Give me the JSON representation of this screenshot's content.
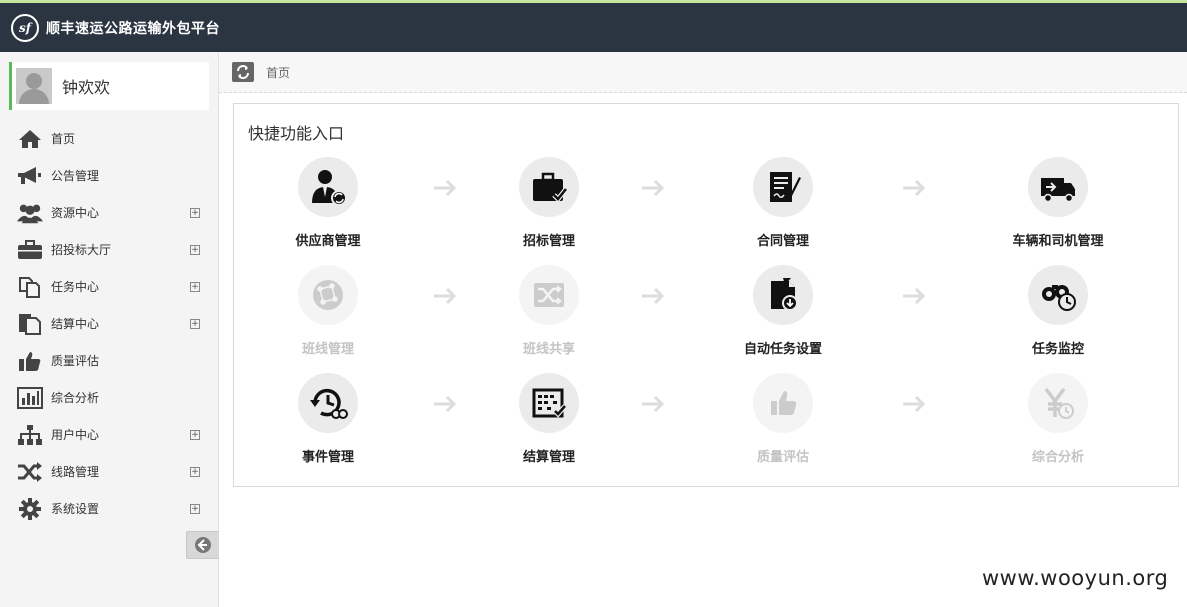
{
  "header": {
    "logo_text": "sf",
    "title": "顺丰速运公路运输外包平台"
  },
  "user": {
    "name": "钟欢欢"
  },
  "sidebar": {
    "items": [
      {
        "label": "首页",
        "icon": "home-icon",
        "expandable": false
      },
      {
        "label": "公告管理",
        "icon": "megaphone-icon",
        "expandable": false
      },
      {
        "label": "资源中心",
        "icon": "users-icon",
        "expandable": true
      },
      {
        "label": "招投标大厅",
        "icon": "briefcase-icon",
        "expandable": true
      },
      {
        "label": "任务中心",
        "icon": "copy-icon",
        "expandable": true
      },
      {
        "label": "结算中心",
        "icon": "document-icon",
        "expandable": true
      },
      {
        "label": "质量评估",
        "icon": "thumbs-up-icon",
        "expandable": false
      },
      {
        "label": "综合分析",
        "icon": "bar-chart-icon",
        "expandable": false
      },
      {
        "label": "用户中心",
        "icon": "sitemap-icon",
        "expandable": true
      },
      {
        "label": "线路管理",
        "icon": "shuffle-icon",
        "expandable": true
      },
      {
        "label": "系统设置",
        "icon": "gear-icon",
        "expandable": true
      }
    ],
    "expand_symbol": "+"
  },
  "breadcrumb": {
    "current": "首页"
  },
  "quick_panel": {
    "title": "快捷功能入口",
    "tiles": [
      {
        "label": "供应商管理",
        "icon": "supplier-icon",
        "enabled": true
      },
      {
        "label": "招标管理",
        "icon": "bidding-icon",
        "enabled": true
      },
      {
        "label": "合同管理",
        "icon": "contract-icon",
        "enabled": true
      },
      {
        "label": "车辆和司机管理",
        "icon": "truck-icon",
        "enabled": true
      },
      {
        "label": "班线管理",
        "icon": "network-icon",
        "enabled": false
      },
      {
        "label": "班线共享",
        "icon": "share-icon",
        "enabled": false
      },
      {
        "label": "自动任务设置",
        "icon": "auto-task-icon",
        "enabled": true
      },
      {
        "label": "任务监控",
        "icon": "monitor-icon",
        "enabled": true
      },
      {
        "label": "事件管理",
        "icon": "history-icon",
        "enabled": true
      },
      {
        "label": "结算管理",
        "icon": "abacus-icon",
        "enabled": true
      },
      {
        "label": "质量评估",
        "icon": "thumbs-up-icon",
        "enabled": false
      },
      {
        "label": "综合分析",
        "icon": "yuan-clock-icon",
        "enabled": false
      }
    ]
  },
  "colors": {
    "topbar": "#2b3542",
    "accent_green": "#5cb85c",
    "arrow": "#dddddd"
  },
  "watermark": "www.wooyun.org"
}
